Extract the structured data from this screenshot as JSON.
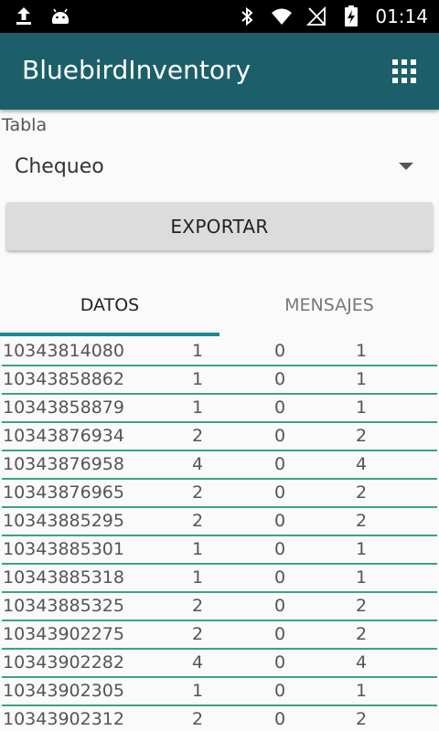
{
  "status_bar": {
    "time": "01:14",
    "icons": [
      "upload-icon",
      "android-icon",
      "bluetooth-icon",
      "wifi-icon",
      "no-sim-icon",
      "battery-charging-icon"
    ]
  },
  "app_bar": {
    "title": "BluebirdInventory",
    "menu_icon": "grid-icon"
  },
  "form": {
    "table_label": "Tabla",
    "table_selected": "Chequeo",
    "export_label": "EXPORTAR"
  },
  "tabs": [
    {
      "label": "DATOS",
      "selected": true
    },
    {
      "label": "MENSAJES",
      "selected": false
    }
  ],
  "rows": [
    [
      "10343814080",
      "1",
      "0",
      "1"
    ],
    [
      "10343858862",
      "1",
      "0",
      "1"
    ],
    [
      "10343858879",
      "1",
      "0",
      "1"
    ],
    [
      "10343876934",
      "2",
      "0",
      "2"
    ],
    [
      "10343876958",
      "4",
      "0",
      "4"
    ],
    [
      "10343876965",
      "2",
      "0",
      "2"
    ],
    [
      "10343885295",
      "2",
      "0",
      "2"
    ],
    [
      "10343885301",
      "1",
      "0",
      "1"
    ],
    [
      "10343885318",
      "1",
      "0",
      "1"
    ],
    [
      "10343885325",
      "2",
      "0",
      "2"
    ],
    [
      "10343902275",
      "2",
      "0",
      "2"
    ],
    [
      "10343902282",
      "4",
      "0",
      "4"
    ],
    [
      "10343902305",
      "1",
      "0",
      "1"
    ],
    [
      "10343902312",
      "2",
      "0",
      "2"
    ]
  ],
  "colors": {
    "app_bar": "#1c5f6b",
    "tab_indicator": "#1c8a8f",
    "row_divider": "#3aa676"
  }
}
